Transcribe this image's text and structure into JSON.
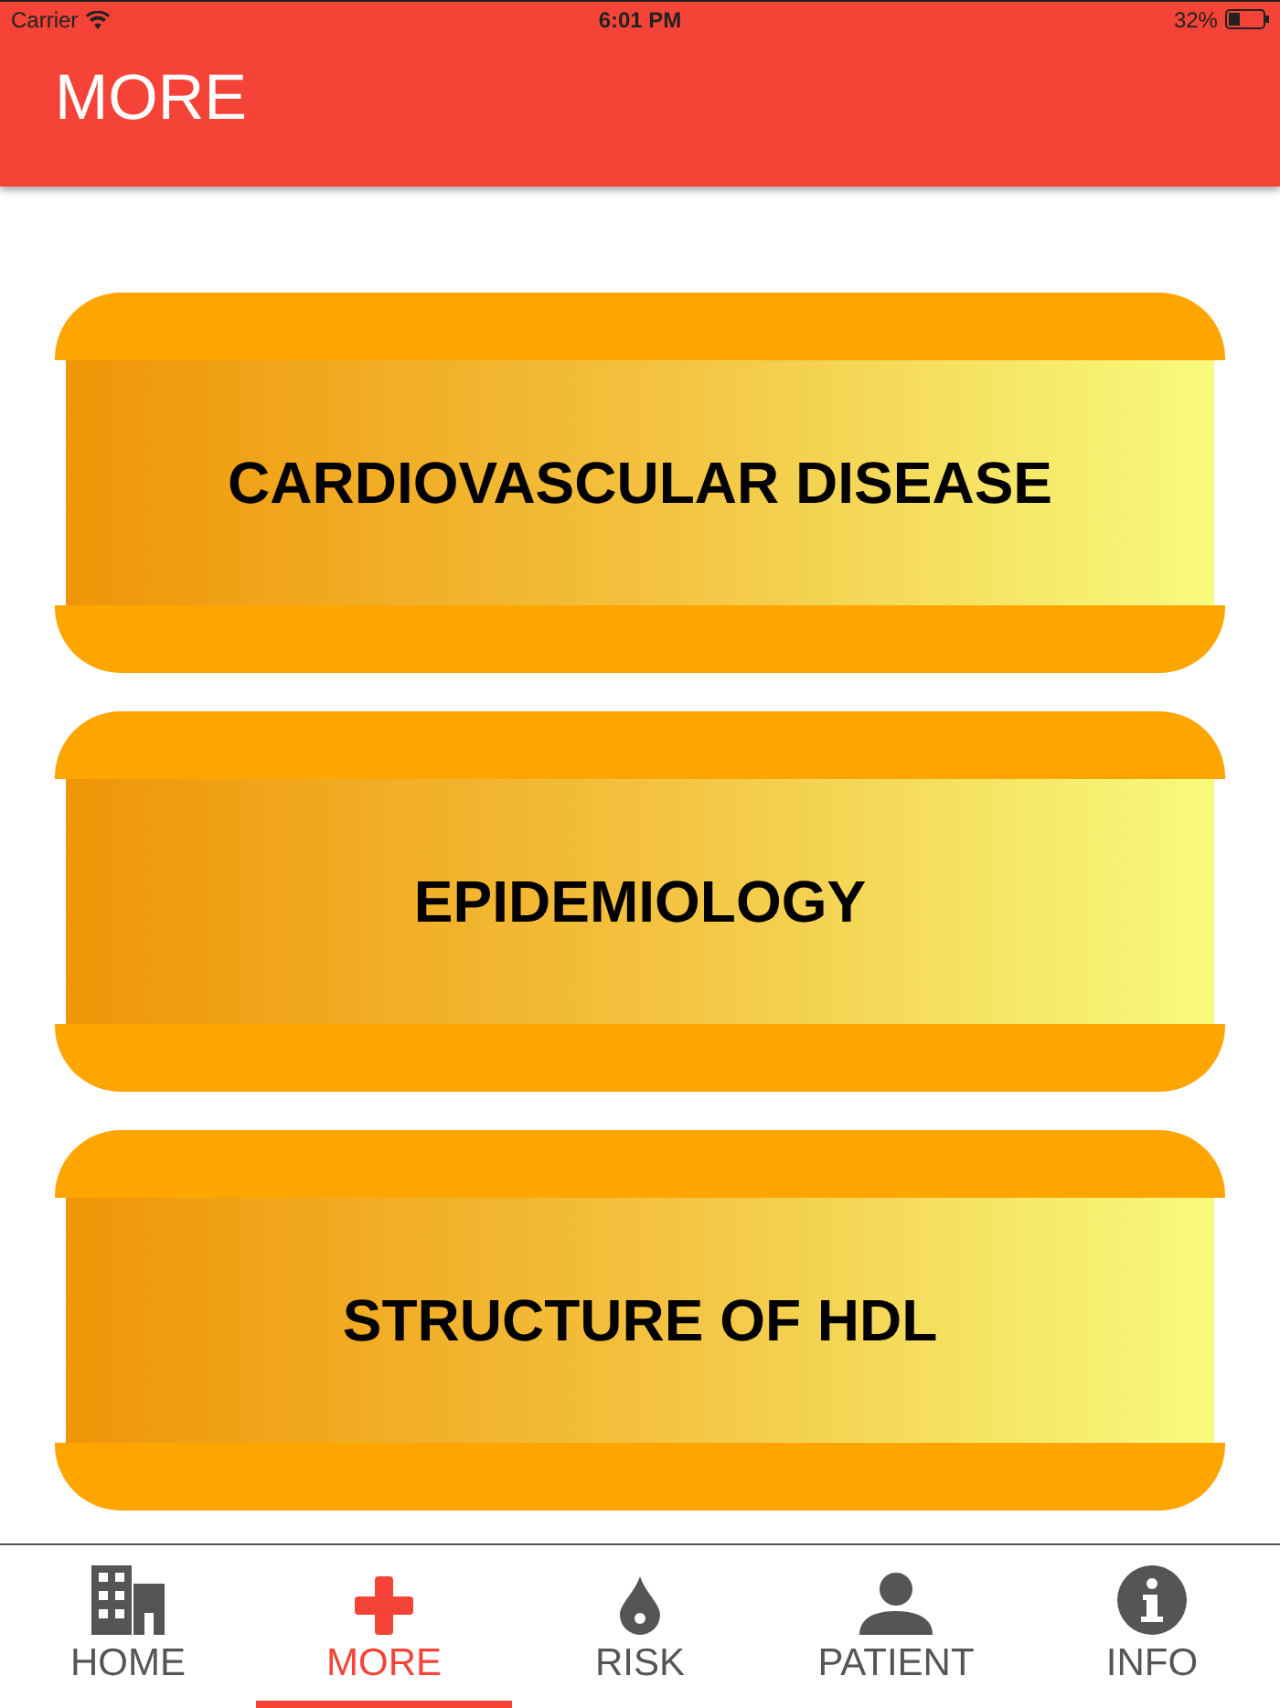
{
  "status_bar": {
    "carrier": "Carrier",
    "time": "6:01 PM",
    "battery": "32%"
  },
  "header": {
    "title": "MORE"
  },
  "items": [
    {
      "label": "CARDIOVASCULAR DISEASE"
    },
    {
      "label": "EPIDEMIOLOGY"
    },
    {
      "label": "STRUCTURE OF HDL"
    }
  ],
  "tab_bar": [
    {
      "label": "HOME",
      "kind": "building",
      "selected": false
    },
    {
      "label": "MORE",
      "kind": "plus",
      "selected": true
    },
    {
      "label": "RISK",
      "kind": "drop",
      "selected": false
    },
    {
      "label": "PATIENT",
      "kind": "person",
      "selected": false
    },
    {
      "label": "INFO",
      "kind": "info",
      "selected": false
    }
  ]
}
